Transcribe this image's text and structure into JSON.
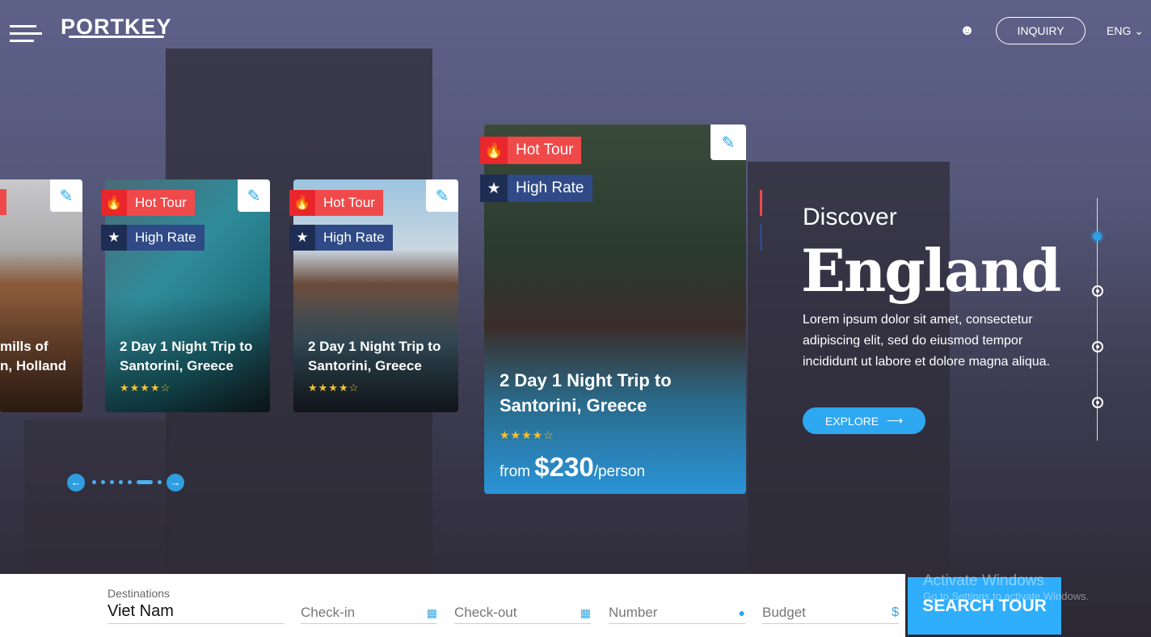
{
  "header": {
    "logo": "PORTKEY",
    "inquiry": "INQUIRY",
    "language": "ENG"
  },
  "cards": [
    {
      "title_l1": "mills of",
      "title_l2": "n, Holland"
    },
    {
      "hot": "Hot Tour",
      "rate": "High Rate",
      "title_l1": "2 Day 1 Night Trip to",
      "title_l2": "Santorini, Greece",
      "stars": "★★★★☆",
      "rating": 4
    },
    {
      "hot": "Hot Tour",
      "rate": "High Rate",
      "title_l1": "2 Day 1 Night Trip to",
      "title_l2": "Santorini, Greece",
      "stars": "★★★★☆",
      "rating": 4
    },
    {
      "hot": "Hot Tour",
      "rate": "High Rate",
      "title_l1": "2 Day 1 Night Trip to",
      "title_l2": "Santorini, Greece",
      "stars": "★★★★☆",
      "rating": 4,
      "from": "from",
      "price": "$230",
      "per": "/person"
    }
  ],
  "hero": {
    "kicker": "Discover",
    "title": "England",
    "body_l1": "Lorem ipsum dolor sit amet, consectetur",
    "body_l2": "adipiscing elit, sed do eiusmod tempor",
    "body_l3": "incididunt ut labore et dolore magna aliqua.",
    "explore": "EXPLORE"
  },
  "search": {
    "dest_label": "Destinations",
    "dest_value": "Viet Nam",
    "checkin": "Check-in",
    "checkout": "Check-out",
    "number": "Number",
    "budget": "Budget",
    "button": "SEARCH TOUR"
  },
  "watermark": {
    "l1": "Activate Windows",
    "l2": "Go to Settings to activate Windows."
  },
  "colors": {
    "accent": "#2ea8e8",
    "hot": "#f0494a",
    "rate": "#2f4a86",
    "search_button": "#2eaefc"
  }
}
